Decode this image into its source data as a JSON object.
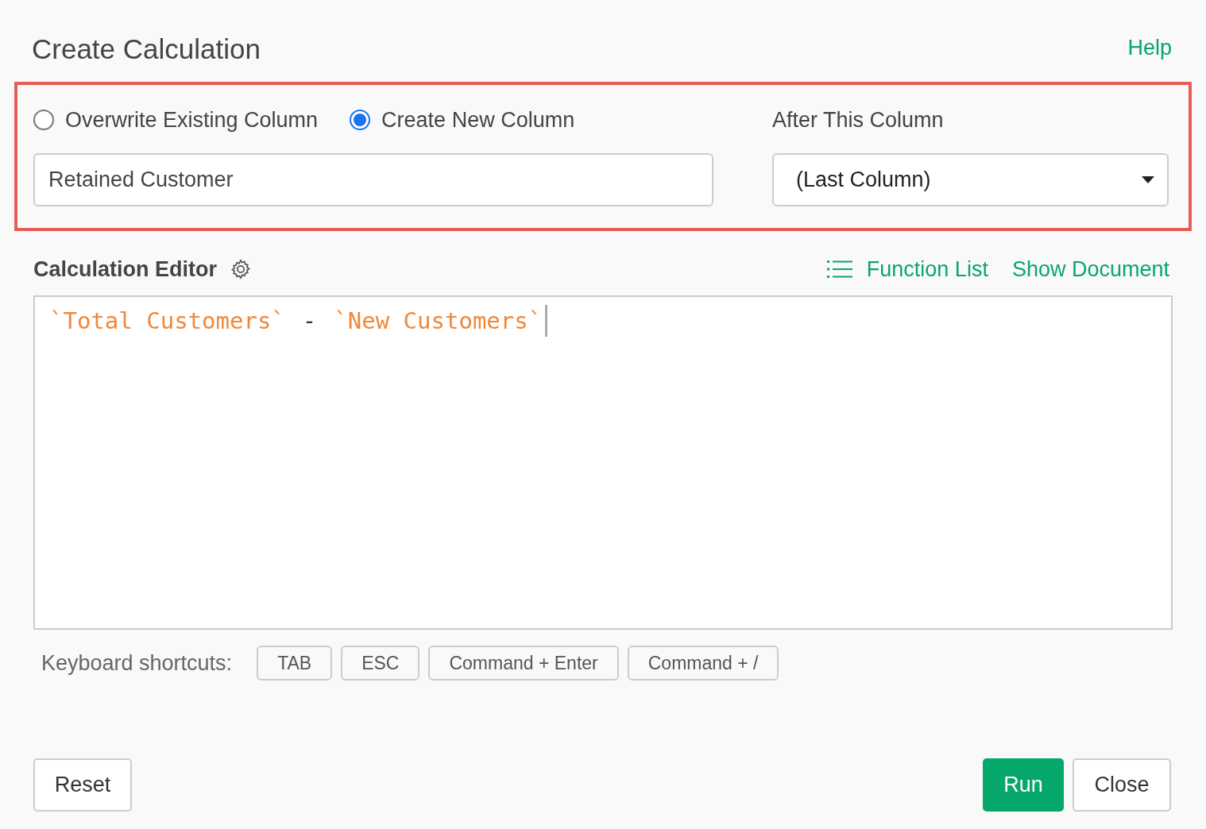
{
  "dialog": {
    "title": "Create Calculation",
    "help_link": "Help"
  },
  "target": {
    "modes": [
      {
        "label": "Overwrite Existing Column",
        "selected": false
      },
      {
        "label": "Create New Column",
        "selected": true
      }
    ],
    "column_name": {
      "value": "Retained Customer"
    },
    "position": {
      "label": "After This Column",
      "value": "(Last Column)"
    }
  },
  "editor": {
    "label": "Calculation Editor",
    "function_list": "Function List",
    "show_document": "Show Document",
    "tokens": [
      {
        "kind": "column",
        "text": "`Total Customers`"
      },
      {
        "kind": "operator",
        "text": "-"
      },
      {
        "kind": "column",
        "text": "`New Customers`"
      }
    ]
  },
  "shortcuts": {
    "label": "Keyboard shortcuts:",
    "keys": [
      "TAB",
      "ESC",
      "Command + Enter",
      "Command + /"
    ]
  },
  "footer": {
    "reset": "Reset",
    "run": "Run",
    "close": "Close"
  }
}
